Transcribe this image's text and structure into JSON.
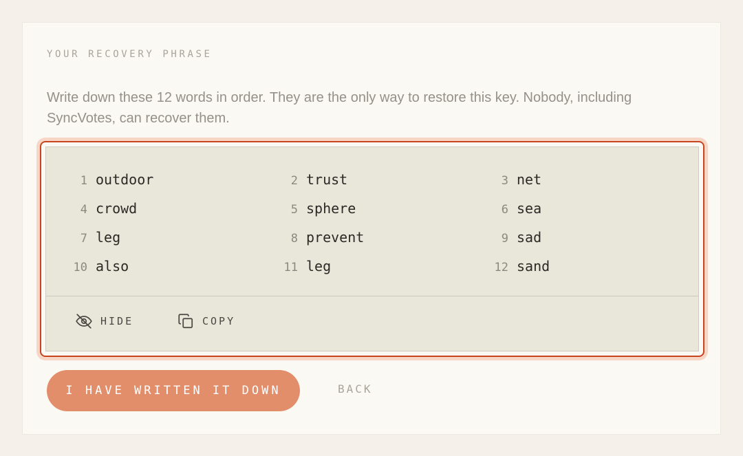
{
  "section": {
    "eyebrow": "YOUR RECOVERY PHRASE",
    "description": "Write down these 12 words in order. They are the only way to restore this key. Nobody, including SyncVotes, can recover them."
  },
  "phrase": {
    "words": [
      {
        "index": "1",
        "word": "outdoor"
      },
      {
        "index": "2",
        "word": "trust"
      },
      {
        "index": "3",
        "word": "net"
      },
      {
        "index": "4",
        "word": "crowd"
      },
      {
        "index": "5",
        "word": "sphere"
      },
      {
        "index": "6",
        "word": "sea"
      },
      {
        "index": "7",
        "word": "leg"
      },
      {
        "index": "8",
        "word": "prevent"
      },
      {
        "index": "9",
        "word": "sad"
      },
      {
        "index": "10",
        "word": "also"
      },
      {
        "index": "11",
        "word": "leg"
      },
      {
        "index": "12",
        "word": "sand"
      }
    ],
    "hide_label": "HIDE",
    "copy_label": "COPY",
    "hide_icon": "eye-off-icon",
    "copy_icon": "copy-icon"
  },
  "footer": {
    "confirm_label": "I HAVE WRITTEN IT DOWN",
    "back_label": "BACK"
  },
  "colors": {
    "accent": "#e38e6b",
    "focus_ring": "#c8431e",
    "panel": "#e9e6da"
  }
}
